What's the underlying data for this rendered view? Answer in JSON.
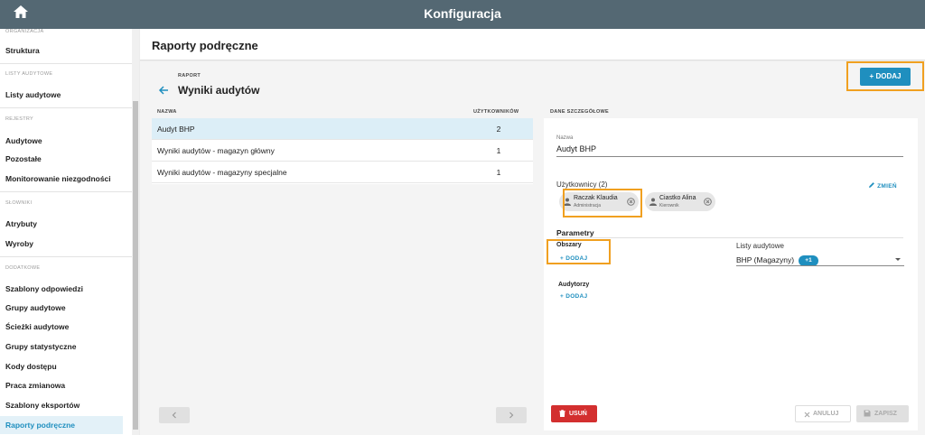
{
  "app": {
    "title": "Konfiguracja",
    "home_icon": "home-icon"
  },
  "sidebar": {
    "categories": {
      "organizacja": "ORGANIZACJA",
      "listy": "LISTY AUDYTOWE",
      "rejestry": "REJESTRY",
      "slowniki": "SŁOWNIKI",
      "dodatkowe": "DODATKOWE"
    },
    "items": {
      "struktura": "Struktura",
      "listy_audytowe": "Listy audytowe",
      "audytowe": "Audytowe",
      "pozostale": "Pozostałe",
      "monitorowanie": "Monitorowanie niezgodności",
      "atrybuty": "Atrybuty",
      "wyroby": "Wyroby",
      "szablony_odpowiedzi": "Szablony odpowiedzi",
      "grupy_audytowe": "Grupy audytowe",
      "sciezki": "Ścieżki audytowe",
      "grupy_stat": "Grupy statystyczne",
      "kody": "Kody dostępu",
      "praca": "Praca zmianowa",
      "szablony_eksportow": "Szablony eksportów",
      "raporty": "Raporty podręczne"
    },
    "active": "Raporty podręczne"
  },
  "page": {
    "title": "Raporty podręczne"
  },
  "report": {
    "caption": "RAPORT",
    "title": "Wyniki audytów"
  },
  "toolbar": {
    "add_label": "+ DODAJ"
  },
  "table": {
    "col_name": "NAZWA",
    "col_users": "UŻYTKOWNIKÓW",
    "rows": [
      {
        "name": "Audyt BHP",
        "users": "2"
      },
      {
        "name": "Wyniki audytów - magazyn główny",
        "users": "1"
      },
      {
        "name": "Wyniki audytów - magazyny specjalne",
        "users": "1"
      }
    ]
  },
  "details": {
    "header": "DANE SZCZEGÓŁOWE",
    "name_label": "Nazwa",
    "name_value": "Audyt BHP",
    "users_label": "Użytkownicy (2)",
    "edit_label": "ZMIEŃ",
    "users": [
      {
        "name": "Raczak Klaudia",
        "role": "Administracja"
      },
      {
        "name": "Ciastko Alina",
        "role": "Kierownik"
      }
    ],
    "params_title": "Parametry",
    "areas_label": "Obszary",
    "areas_add": "+ DODAJ",
    "lists_label": "Listy audytowe",
    "lists_value": "BHP (Magazyny)",
    "lists_extra": "+1",
    "auditors_label": "Audytorzy",
    "auditors_add": "+ DODAJ"
  },
  "footer": {
    "delete_label": "USUŃ",
    "cancel_label": "ANULUJ",
    "save_label": "ZAPISZ"
  },
  "colors": {
    "topbar": "#546873",
    "accent": "#1f8fbf",
    "danger": "#d32f2f",
    "highlight": "#f0a020"
  }
}
